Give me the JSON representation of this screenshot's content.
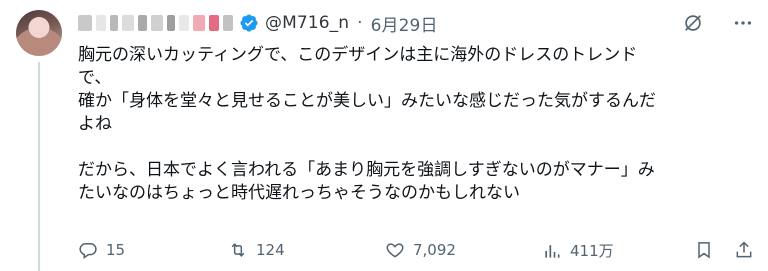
{
  "author": {
    "handle": "@M716_n",
    "separator": "·",
    "date": "6月29日"
  },
  "tweet": {
    "lines": [
      "胸元の深いカッティングで、このデザインは主に海外のドレスのトレンド",
      "で、",
      "確か「身体を堂々と見せることが美しい」みたいな感じだった気がするんだ",
      "よね",
      "",
      "だから、日本でよく言われる「あまり胸元を強調しすぎないのがマナー」み",
      "たいなのはちょっと時代遅れっちゃそうなのかもしれない"
    ]
  },
  "actions": {
    "replies": "15",
    "retweets": "124",
    "likes": "7,092",
    "views": "411万"
  },
  "colors": {
    "accent": "#1d9bf0",
    "muted": "#536471",
    "text": "#0f1419"
  },
  "icons": [
    "verified-badge-icon",
    "grok-icon",
    "more-icon",
    "reply-icon",
    "retweet-icon",
    "like-icon",
    "views-icon",
    "bookmark-icon",
    "share-icon"
  ]
}
